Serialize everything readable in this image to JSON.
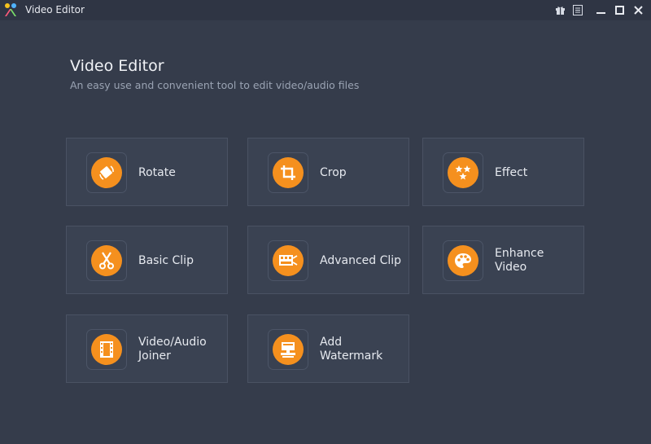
{
  "window": {
    "title": "Video Editor",
    "icons": [
      "gift-icon",
      "feedback-icon",
      "minimize-icon",
      "maximize-icon",
      "close-icon"
    ]
  },
  "header": {
    "title": "Video Editor",
    "subtitle": "An easy use and convenient tool to edit video/audio files"
  },
  "tools": [
    {
      "label": "Rotate",
      "icon": "rotate-icon"
    },
    {
      "label": "Crop",
      "icon": "crop-icon"
    },
    {
      "label": "Effect",
      "icon": "effect-icon"
    },
    {
      "label": "Basic Clip",
      "icon": "scissors-icon"
    },
    {
      "label": "Advanced Clip",
      "icon": "advanced-clip-icon"
    },
    {
      "label": "Enhance\nVideo",
      "icon": "palette-icon"
    },
    {
      "label": "Video/Audio\nJoiner",
      "icon": "film-joiner-icon"
    },
    {
      "label": "Add\nWatermark",
      "icon": "watermark-icon"
    }
  ],
  "colors": {
    "background": "#353c4b",
    "titlebar": "#2f3544",
    "tile": "#3a4252",
    "accent": "#f5901e"
  }
}
